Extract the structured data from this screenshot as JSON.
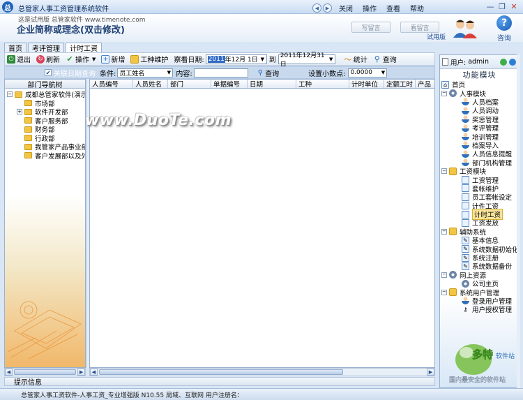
{
  "titlebar": {
    "app_title": "总管家人事工资管理系统软件",
    "menu": [
      "关闭",
      "操作",
      "查看",
      "帮助"
    ]
  },
  "header": {
    "trial_note": "这是试用版 总管家软件 www.timenote.com",
    "company_text": "企业简称或理念(双击修改)",
    "btn_write": "写留言",
    "btn_view": "看留言",
    "edition": "试用版",
    "help_label": "咨询"
  },
  "tabs": [
    "首页",
    "考评管理",
    "计时工资"
  ],
  "toolbar": {
    "exit": "退出",
    "refresh": "刷新",
    "operate": "操作",
    "add": "新增",
    "type_maint": "工种维护",
    "view_date": "察看日期:",
    "date_from": "2011年12月 1日",
    "date_from_sel": "2011",
    "date_from_rest": "年12月 1日",
    "to": "到",
    "date_to": "2011年12月31日",
    "stats": "统计",
    "query": "查询"
  },
  "filter": {
    "link_date": "关联日期查询",
    "condition_label": "条件:",
    "condition_value": "员工姓名",
    "content_label": "内容:",
    "content_value": "",
    "query_btn": "查询",
    "decimal_label": "设置小数点:",
    "decimal_value": "0.0000"
  },
  "left_tree": {
    "header": "部门导航树",
    "root": "成都总管家软件(演示",
    "items": [
      {
        "label": "市场部",
        "expandable": false
      },
      {
        "label": "软件开发部",
        "expandable": true
      },
      {
        "label": "客户服务部",
        "expandable": false
      },
      {
        "label": "财务部",
        "expandable": false
      },
      {
        "label": "行政部",
        "expandable": false
      },
      {
        "label": "我管家产品事业部",
        "expandable": false
      },
      {
        "label": "客户发展部以及外",
        "expandable": false
      }
    ]
  },
  "grid": {
    "columns": [
      "人员编号",
      "人员姓名",
      "部门",
      "单据编号",
      "日期",
      "工种",
      "计时单位",
      "定额工时",
      "产品"
    ],
    "rows": []
  },
  "watermark": "www.DuoTe.com",
  "tips_label": "提示信息",
  "status_bar": "总管家人事工资软件-人事工资_专业增强版 N10.55 局域、互联网 用户注册名：",
  "right_panel": {
    "user_label": "用户:",
    "user_value": "admin",
    "header": "功能模块",
    "tree": [
      {
        "label": "首页",
        "level": 0,
        "icon": "home-icon"
      },
      {
        "label": "人事模块",
        "level": 0,
        "icon": "gear-icon"
      },
      {
        "label": "人员档案",
        "level": 1,
        "icon": "person-icon"
      },
      {
        "label": "人员调动",
        "level": 1,
        "icon": "person-icon"
      },
      {
        "label": "奖惩管理",
        "level": 1,
        "icon": "person-icon"
      },
      {
        "label": "考评管理",
        "level": 1,
        "icon": "person-icon"
      },
      {
        "label": "培训管理",
        "level": 1,
        "icon": "person-icon"
      },
      {
        "label": "档案导入",
        "level": 1,
        "icon": "person-icon"
      },
      {
        "label": "人员信息提醒",
        "level": 1,
        "icon": "person-icon"
      },
      {
        "label": "部门机构管理",
        "level": 1,
        "icon": "person-icon"
      },
      {
        "label": "工资模块",
        "level": 0,
        "icon": "folder-icon"
      },
      {
        "label": "工资管理",
        "level": 1,
        "icon": "doc-icon"
      },
      {
        "label": "套帐维护",
        "level": 1,
        "icon": "doc-icon"
      },
      {
        "label": "员工套帐设定",
        "level": 1,
        "icon": "doc-icon"
      },
      {
        "label": "计件工资",
        "level": 1,
        "icon": "doc-icon"
      },
      {
        "label": "计时工资",
        "level": 1,
        "icon": "doc-icon",
        "selected": true
      },
      {
        "label": "工资发放",
        "level": 1,
        "icon": "doc-icon"
      },
      {
        "label": "辅助系统",
        "level": 0,
        "icon": "folder-icon"
      },
      {
        "label": "基本信息",
        "level": 1,
        "icon": "tool-icon"
      },
      {
        "label": "系统数据初始化",
        "level": 1,
        "icon": "tool-icon"
      },
      {
        "label": "系统注册",
        "level": 1,
        "icon": "tool-icon"
      },
      {
        "label": "系统数据备份",
        "level": 1,
        "icon": "tool-icon"
      },
      {
        "label": "网上资源",
        "level": 0,
        "icon": "globe-icon"
      },
      {
        "label": "公司主页",
        "level": 1,
        "icon": "globe-icon"
      },
      {
        "label": "系统用户管理",
        "level": 0,
        "icon": "folder-icon"
      },
      {
        "label": "登录用户管理",
        "level": 1,
        "icon": "users-icon"
      },
      {
        "label": "用户授权管理",
        "level": 1,
        "icon": "key-icon"
      }
    ],
    "logo_text": "多特软件站",
    "logo_sub": "国内最安全的软件站"
  },
  "colors": {
    "accent": "#1f64b8",
    "panel_border": "#98b1d0",
    "selected_bg": "#f7e49a",
    "date_selection": "#316ac5"
  }
}
